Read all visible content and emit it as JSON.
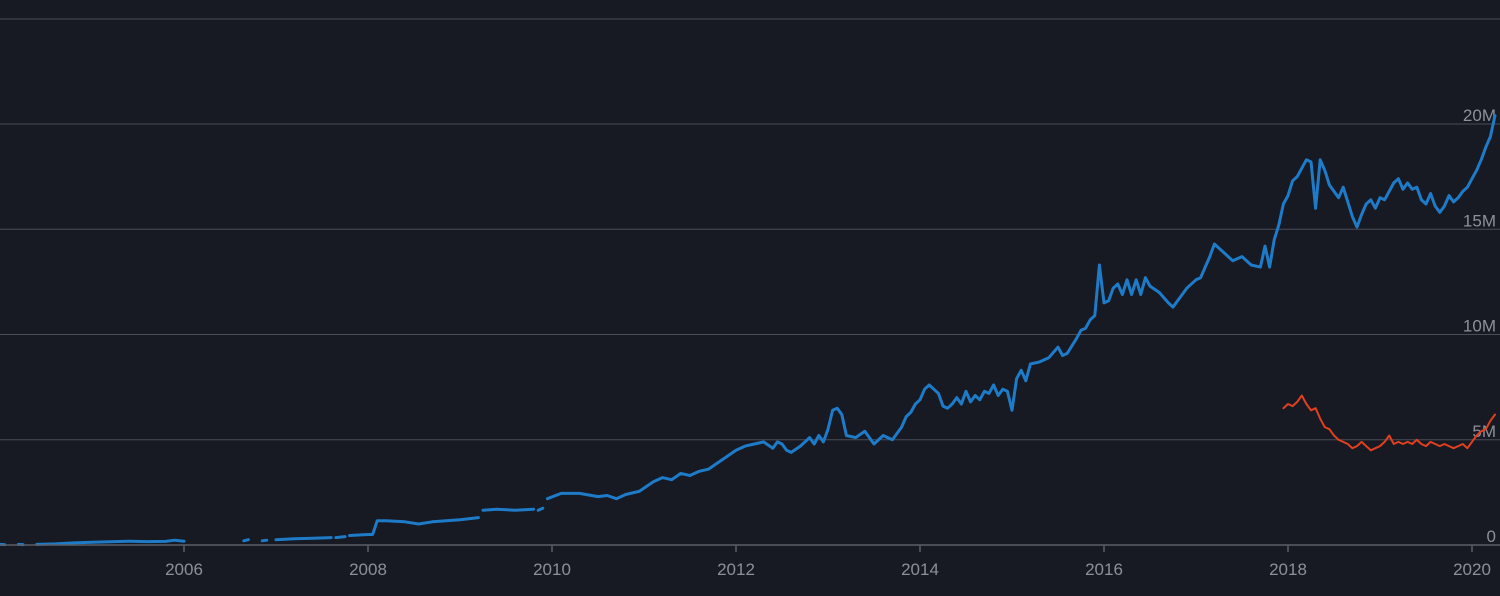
{
  "chart_data": {
    "type": "line",
    "title": "",
    "xlabel": "",
    "ylabel": "",
    "xlim": [
      2004.0,
      2020.25
    ],
    "ylim": [
      0,
      20000000
    ],
    "grid": true,
    "x_ticks": [
      2006,
      2008,
      2010,
      2012,
      2014,
      2016,
      2018,
      2020
    ],
    "x_tick_labels": [
      "2006",
      "2008",
      "2010",
      "2012",
      "2014",
      "2016",
      "2018",
      "2020"
    ],
    "y_ticks": [
      0,
      5000000,
      10000000,
      15000000,
      20000000
    ],
    "y_tick_labels": [
      "0",
      "5M",
      "10M",
      "15M",
      "20M"
    ],
    "series": [
      {
        "color": "#1e7bc8",
        "segments": [
          [
            [
              2004.0,
              30000
            ],
            [
              2004.05,
              20000
            ]
          ],
          [
            [
              2004.2,
              30000
            ],
            [
              2004.25,
              20000
            ]
          ],
          [
            [
              2004.4,
              30000
            ],
            [
              2004.6,
              50000
            ],
            [
              2004.8,
              100000
            ],
            [
              2005.0,
              130000
            ],
            [
              2005.2,
              150000
            ],
            [
              2005.4,
              180000
            ],
            [
              2005.6,
              160000
            ],
            [
              2005.8,
              170000
            ],
            [
              2005.9,
              230000
            ],
            [
              2006.0,
              180000
            ]
          ],
          [
            [
              2006.65,
              200000
            ],
            [
              2006.7,
              250000
            ]
          ],
          [
            [
              2006.85,
              200000
            ],
            [
              2006.9,
              230000
            ]
          ],
          [
            [
              2007.0,
              250000
            ],
            [
              2007.2,
              300000
            ],
            [
              2007.4,
              320000
            ],
            [
              2007.6,
              350000
            ]
          ],
          [
            [
              2007.65,
              350000
            ],
            [
              2007.75,
              400000
            ]
          ],
          [
            [
              2007.8,
              450000
            ],
            [
              2008.0,
              500000
            ],
            [
              2008.05,
              500000
            ],
            [
              2008.1,
              1150000
            ],
            [
              2008.2,
              1150000
            ],
            [
              2008.4,
              1100000
            ],
            [
              2008.55,
              1000000
            ],
            [
              2008.7,
              1100000
            ],
            [
              2009.0,
              1200000
            ],
            [
              2009.2,
              1300000
            ]
          ],
          [
            [
              2009.25,
              1650000
            ],
            [
              2009.4,
              1700000
            ],
            [
              2009.6,
              1650000
            ],
            [
              2009.8,
              1700000
            ]
          ],
          [
            [
              2009.85,
              1650000
            ],
            [
              2009.9,
              1750000
            ]
          ],
          [
            [
              2009.95,
              2200000
            ],
            [
              2010.1,
              2450000
            ],
            [
              2010.3,
              2450000
            ],
            [
              2010.5,
              2300000
            ],
            [
              2010.6,
              2350000
            ],
            [
              2010.7,
              2200000
            ],
            [
              2010.8,
              2400000
            ],
            [
              2010.95,
              2550000
            ],
            [
              2011.1,
              3000000
            ],
            [
              2011.2,
              3200000
            ],
            [
              2011.3,
              3100000
            ],
            [
              2011.4,
              3400000
            ],
            [
              2011.5,
              3300000
            ],
            [
              2011.6,
              3500000
            ],
            [
              2011.7,
              3600000
            ],
            [
              2011.8,
              3900000
            ],
            [
              2011.9,
              4200000
            ],
            [
              2012.0,
              4500000
            ],
            [
              2012.1,
              4700000
            ],
            [
              2012.2,
              4800000
            ],
            [
              2012.3,
              4900000
            ],
            [
              2012.4,
              4600000
            ],
            [
              2012.45,
              4900000
            ],
            [
              2012.5,
              4800000
            ],
            [
              2012.55,
              4500000
            ],
            [
              2012.6,
              4400000
            ],
            [
              2012.7,
              4700000
            ],
            [
              2012.8,
              5100000
            ],
            [
              2012.85,
              4800000
            ],
            [
              2012.9,
              5200000
            ],
            [
              2012.95,
              4900000
            ],
            [
              2013.0,
              5500000
            ],
            [
              2013.05,
              6400000
            ],
            [
              2013.1,
              6500000
            ],
            [
              2013.15,
              6200000
            ],
            [
              2013.2,
              5200000
            ],
            [
              2013.3,
              5100000
            ],
            [
              2013.4,
              5400000
            ],
            [
              2013.5,
              4800000
            ],
            [
              2013.6,
              5200000
            ],
            [
              2013.7,
              5000000
            ],
            [
              2013.8,
              5600000
            ],
            [
              2013.85,
              6100000
            ],
            [
              2013.9,
              6300000
            ],
            [
              2013.95,
              6700000
            ],
            [
              2014.0,
              6900000
            ],
            [
              2014.05,
              7400000
            ],
            [
              2014.1,
              7600000
            ],
            [
              2014.15,
              7400000
            ],
            [
              2014.2,
              7200000
            ],
            [
              2014.25,
              6600000
            ],
            [
              2014.3,
              6500000
            ],
            [
              2014.35,
              6700000
            ],
            [
              2014.4,
              7000000
            ],
            [
              2014.45,
              6700000
            ],
            [
              2014.5,
              7300000
            ],
            [
              2014.55,
              6800000
            ],
            [
              2014.6,
              7100000
            ],
            [
              2014.65,
              6900000
            ],
            [
              2014.7,
              7300000
            ],
            [
              2014.75,
              7200000
            ],
            [
              2014.8,
              7600000
            ],
            [
              2014.85,
              7100000
            ],
            [
              2014.9,
              7400000
            ],
            [
              2014.95,
              7300000
            ],
            [
              2015.0,
              6400000
            ],
            [
              2015.05,
              7900000
            ],
            [
              2015.1,
              8300000
            ],
            [
              2015.15,
              7800000
            ],
            [
              2015.2,
              8600000
            ],
            [
              2015.3,
              8700000
            ],
            [
              2015.4,
              8900000
            ],
            [
              2015.5,
              9400000
            ],
            [
              2015.55,
              9000000
            ],
            [
              2015.6,
              9100000
            ],
            [
              2015.7,
              9800000
            ],
            [
              2015.75,
              10200000
            ],
            [
              2015.8,
              10300000
            ],
            [
              2015.85,
              10700000
            ],
            [
              2015.9,
              10900000
            ],
            [
              2015.95,
              13300000
            ],
            [
              2016.0,
              11500000
            ],
            [
              2016.05,
              11600000
            ],
            [
              2016.1,
              12200000
            ],
            [
              2016.15,
              12400000
            ],
            [
              2016.2,
              11900000
            ],
            [
              2016.25,
              12600000
            ],
            [
              2016.3,
              11900000
            ],
            [
              2016.35,
              12600000
            ],
            [
              2016.4,
              11900000
            ],
            [
              2016.45,
              12700000
            ],
            [
              2016.5,
              12300000
            ],
            [
              2016.6,
              12000000
            ],
            [
              2016.7,
              11500000
            ],
            [
              2016.75,
              11300000
            ],
            [
              2016.8,
              11600000
            ],
            [
              2016.9,
              12200000
            ],
            [
              2017.0,
              12600000
            ],
            [
              2017.05,
              12700000
            ],
            [
              2017.1,
              13200000
            ],
            [
              2017.15,
              13700000
            ],
            [
              2017.2,
              14300000
            ],
            [
              2017.3,
              13900000
            ],
            [
              2017.4,
              13500000
            ],
            [
              2017.5,
              13700000
            ],
            [
              2017.6,
              13300000
            ],
            [
              2017.7,
              13200000
            ],
            [
              2017.75,
              14200000
            ],
            [
              2017.8,
              13200000
            ],
            [
              2017.85,
              14500000
            ],
            [
              2017.9,
              15200000
            ],
            [
              2017.95,
              16200000
            ],
            [
              2018.0,
              16600000
            ],
            [
              2018.05,
              17300000
            ],
            [
              2018.1,
              17500000
            ],
            [
              2018.15,
              17900000
            ],
            [
              2018.2,
              18300000
            ],
            [
              2018.25,
              18200000
            ],
            [
              2018.3,
              16000000
            ],
            [
              2018.35,
              18300000
            ],
            [
              2018.4,
              17800000
            ],
            [
              2018.45,
              17100000
            ],
            [
              2018.5,
              16800000
            ],
            [
              2018.55,
              16500000
            ],
            [
              2018.6,
              17000000
            ],
            [
              2018.65,
              16300000
            ],
            [
              2018.7,
              15600000
            ],
            [
              2018.75,
              15100000
            ],
            [
              2018.8,
              15700000
            ],
            [
              2018.85,
              16200000
            ],
            [
              2018.9,
              16400000
            ],
            [
              2018.95,
              16000000
            ],
            [
              2019.0,
              16500000
            ],
            [
              2019.05,
              16400000
            ],
            [
              2019.1,
              16800000
            ],
            [
              2019.15,
              17200000
            ],
            [
              2019.2,
              17400000
            ],
            [
              2019.25,
              16900000
            ],
            [
              2019.3,
              17200000
            ],
            [
              2019.35,
              16900000
            ],
            [
              2019.4,
              17000000
            ],
            [
              2019.45,
              16400000
            ],
            [
              2019.5,
              16200000
            ],
            [
              2019.55,
              16700000
            ],
            [
              2019.6,
              16100000
            ],
            [
              2019.65,
              15800000
            ],
            [
              2019.7,
              16100000
            ],
            [
              2019.75,
              16600000
            ],
            [
              2019.8,
              16300000
            ],
            [
              2019.85,
              16500000
            ],
            [
              2019.9,
              16800000
            ],
            [
              2019.95,
              17000000
            ],
            [
              2020.0,
              17400000
            ],
            [
              2020.05,
              17800000
            ],
            [
              2020.1,
              18300000
            ],
            [
              2020.15,
              18900000
            ],
            [
              2020.2,
              19400000
            ],
            [
              2020.25,
              20400000
            ]
          ]
        ]
      },
      {
        "color": "#e0401f",
        "segments": [
          [
            [
              2017.95,
              6500000
            ],
            [
              2018.0,
              6700000
            ],
            [
              2018.05,
              6600000
            ],
            [
              2018.1,
              6800000
            ],
            [
              2018.15,
              7100000
            ],
            [
              2018.2,
              6700000
            ],
            [
              2018.25,
              6400000
            ],
            [
              2018.3,
              6500000
            ],
            [
              2018.35,
              6000000
            ],
            [
              2018.4,
              5600000
            ],
            [
              2018.45,
              5500000
            ],
            [
              2018.5,
              5200000
            ],
            [
              2018.55,
              5000000
            ],
            [
              2018.6,
              4900000
            ],
            [
              2018.65,
              4800000
            ],
            [
              2018.7,
              4600000
            ],
            [
              2018.75,
              4700000
            ],
            [
              2018.8,
              4900000
            ],
            [
              2018.85,
              4700000
            ],
            [
              2018.9,
              4500000
            ],
            [
              2018.95,
              4600000
            ],
            [
              2019.0,
              4700000
            ],
            [
              2019.05,
              4900000
            ],
            [
              2019.1,
              5200000
            ],
            [
              2019.15,
              4800000
            ],
            [
              2019.2,
              4900000
            ],
            [
              2019.25,
              4800000
            ],
            [
              2019.3,
              4900000
            ],
            [
              2019.35,
              4800000
            ],
            [
              2019.4,
              5000000
            ],
            [
              2019.45,
              4800000
            ],
            [
              2019.5,
              4700000
            ],
            [
              2019.55,
              4900000
            ],
            [
              2019.6,
              4800000
            ],
            [
              2019.65,
              4700000
            ],
            [
              2019.7,
              4800000
            ],
            [
              2019.75,
              4700000
            ],
            [
              2019.8,
              4600000
            ],
            [
              2019.85,
              4700000
            ],
            [
              2019.9,
              4800000
            ],
            [
              2019.95,
              4600000
            ],
            [
              2020.0,
              4900000
            ],
            [
              2020.05,
              5200000
            ],
            [
              2020.1,
              5400000
            ],
            [
              2020.15,
              5500000
            ],
            [
              2020.2,
              5900000
            ],
            [
              2020.25,
              6200000
            ]
          ]
        ]
      }
    ]
  }
}
